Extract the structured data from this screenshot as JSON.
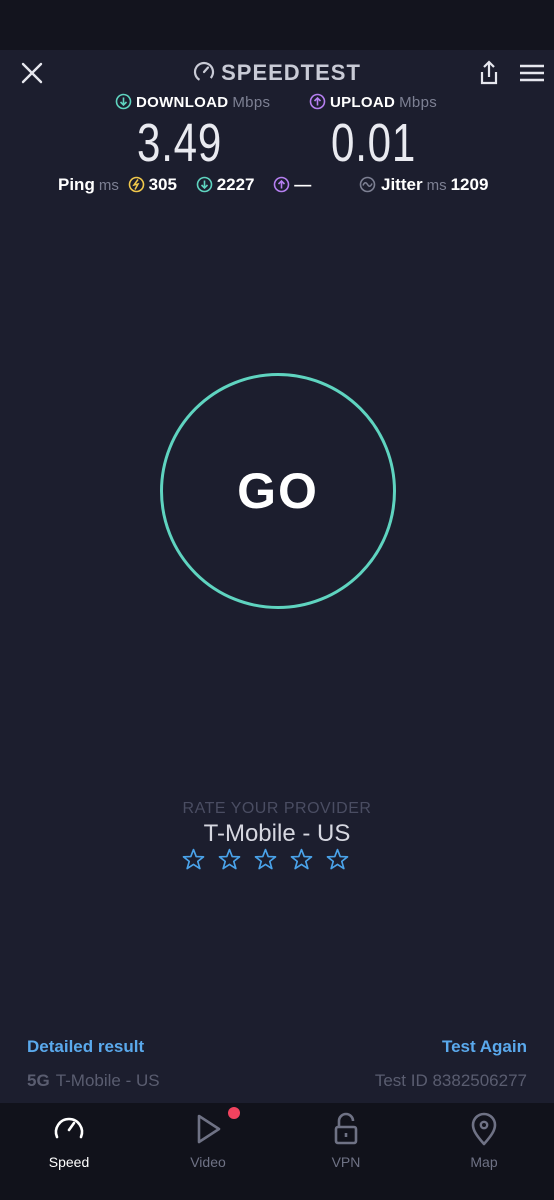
{
  "app": {
    "title": "SPEEDTEST"
  },
  "header": {
    "close_icon": "close-icon",
    "share_icon": "share-icon",
    "menu_icon": "menu-icon"
  },
  "download": {
    "label": "DOWNLOAD",
    "unit": "Mbps",
    "value": "3.49",
    "color": "#5fd4c0"
  },
  "upload": {
    "label": "UPLOAD",
    "unit": "Mbps",
    "value": "0.01",
    "color": "#b57ff0"
  },
  "ping": {
    "label": "Ping",
    "unit": "ms",
    "idle": "305",
    "download": "2227",
    "upload": "—"
  },
  "jitter": {
    "label": "Jitter",
    "unit": "ms",
    "value": "1209"
  },
  "go_button": {
    "label": "GO",
    "ring_color": "#5fd4c0"
  },
  "rating": {
    "prompt": "RATE YOUR PROVIDER",
    "provider": "T-Mobile - US",
    "stars_filled": 0,
    "stars_total": 5
  },
  "footer": {
    "detailed_result": "Detailed result",
    "test_again": "Test Again",
    "network_type": "5G",
    "provider": "T-Mobile - US",
    "test_id": "Test ID 8382506277"
  },
  "nav": [
    {
      "label": "Speed",
      "icon": "speedometer-icon",
      "active": true
    },
    {
      "label": "Video",
      "icon": "play-icon",
      "active": false,
      "notification": true
    },
    {
      "label": "VPN",
      "icon": "unlock-icon",
      "active": false
    },
    {
      "label": "Map",
      "icon": "map-pin-icon",
      "active": false
    }
  ]
}
